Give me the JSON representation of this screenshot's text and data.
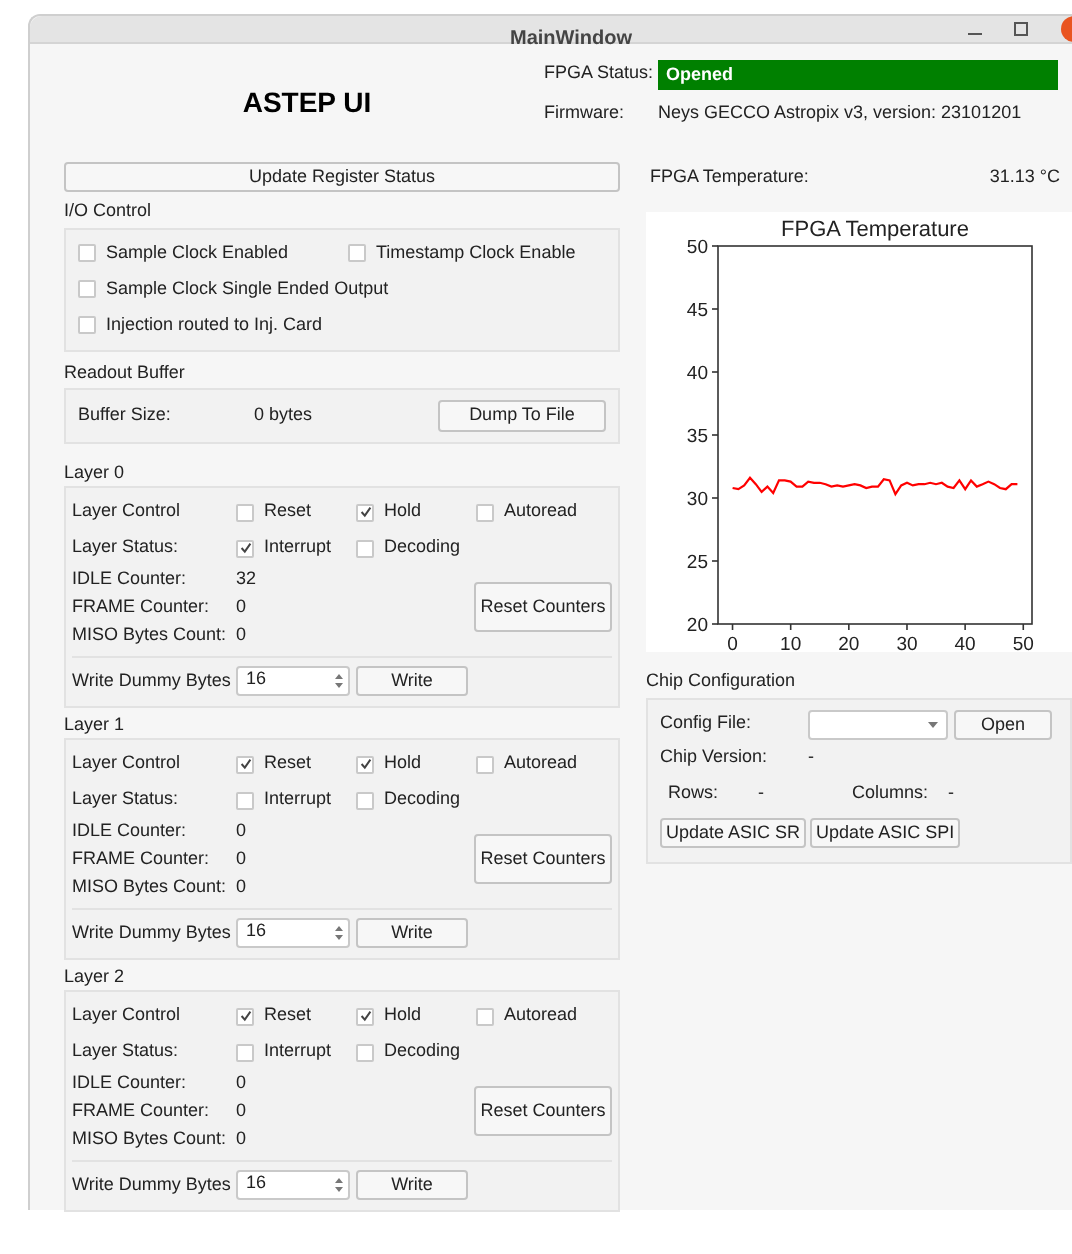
{
  "window": {
    "title": "MainWindow"
  },
  "header": {
    "app_title": "ASTEP UI",
    "fpga_status_label": "FPGA Status:",
    "fpga_status_value": "Opened",
    "firmware_label": "Firmware:",
    "firmware_value": "Neys GECCO Astropix v3, version: 23101201"
  },
  "update_button": "Update Register Status",
  "io_control": {
    "title": "I/O Control",
    "options": [
      {
        "label": "Sample Clock Enabled",
        "checked": false
      },
      {
        "label": "Timestamp Clock Enable",
        "checked": false
      },
      {
        "label": "Sample Clock Single Ended Output",
        "checked": false
      },
      {
        "label": "Injection routed to Inj. Card",
        "checked": false
      }
    ]
  },
  "readout_buffer": {
    "title": "Readout Buffer",
    "buffer_size_label": "Buffer Size:",
    "buffer_size_value": "0 bytes",
    "dump_button": "Dump To File"
  },
  "layers": [
    {
      "title": "Layer 0",
      "control_label": "Layer Control",
      "control": [
        {
          "label": "Reset",
          "checked": false
        },
        {
          "label": "Hold",
          "checked": true
        },
        {
          "label": "Autoread",
          "checked": false
        }
      ],
      "status_label": "Layer Status:",
      "status": [
        {
          "label": "Interrupt",
          "checked": true
        },
        {
          "label": "Decoding",
          "checked": false
        }
      ],
      "counters": [
        {
          "label": "IDLE Counter:",
          "value": "32"
        },
        {
          "label": "FRAME Counter:",
          "value": "0"
        },
        {
          "label": "MISO Bytes Count:",
          "value": "0"
        }
      ],
      "reset_button": "Reset Counters",
      "write_label": "Write Dummy Bytes",
      "write_value": "16",
      "write_button": "Write"
    },
    {
      "title": "Layer 1",
      "control_label": "Layer Control",
      "control": [
        {
          "label": "Reset",
          "checked": true
        },
        {
          "label": "Hold",
          "checked": true
        },
        {
          "label": "Autoread",
          "checked": false
        }
      ],
      "status_label": "Layer Status:",
      "status": [
        {
          "label": "Interrupt",
          "checked": false
        },
        {
          "label": "Decoding",
          "checked": false
        }
      ],
      "counters": [
        {
          "label": "IDLE Counter:",
          "value": "0"
        },
        {
          "label": "FRAME Counter:",
          "value": "0"
        },
        {
          "label": "MISO Bytes Count:",
          "value": "0"
        }
      ],
      "reset_button": "Reset Counters",
      "write_label": "Write Dummy Bytes",
      "write_value": "16",
      "write_button": "Write"
    },
    {
      "title": "Layer 2",
      "control_label": "Layer Control",
      "control": [
        {
          "label": "Reset",
          "checked": true
        },
        {
          "label": "Hold",
          "checked": true
        },
        {
          "label": "Autoread",
          "checked": false
        }
      ],
      "status_label": "Layer Status:",
      "status": [
        {
          "label": "Interrupt",
          "checked": false
        },
        {
          "label": "Decoding",
          "checked": false
        }
      ],
      "counters": [
        {
          "label": "IDLE Counter:",
          "value": "0"
        },
        {
          "label": "FRAME Counter:",
          "value": "0"
        },
        {
          "label": "MISO Bytes Count:",
          "value": "0"
        }
      ],
      "reset_button": "Reset Counters",
      "write_label": "Write Dummy Bytes",
      "write_value": "16",
      "write_button": "Write"
    }
  ],
  "temperature": {
    "label": "FPGA Temperature:",
    "value": "31.13 °C",
    "chart_data": {
      "type": "line",
      "title": "FPGA Temperature",
      "x": [
        0,
        1,
        2,
        3,
        4,
        5,
        6,
        7,
        8,
        9,
        10,
        11,
        12,
        13,
        14,
        15,
        16,
        17,
        18,
        19,
        20,
        21,
        22,
        23,
        24,
        25,
        26,
        27,
        28,
        29,
        30,
        31,
        32,
        33,
        34,
        35,
        36,
        37,
        38,
        39,
        40,
        41,
        42,
        43,
        44,
        45,
        46,
        47,
        48,
        49
      ],
      "series": [
        {
          "color": "#ff0000",
          "values": [
            30.8,
            30.7,
            31.0,
            31.6,
            31.1,
            30.5,
            30.9,
            30.4,
            31.4,
            31.4,
            31.3,
            30.9,
            30.9,
            31.3,
            31.2,
            31.2,
            31.1,
            30.9,
            31.0,
            30.9,
            31.0,
            31.1,
            31.0,
            30.8,
            30.9,
            30.9,
            31.5,
            31.4,
            30.3,
            31.0,
            31.2,
            31.0,
            31.1,
            31.1,
            31.2,
            31.1,
            31.2,
            30.9,
            30.8,
            31.4,
            30.7,
            31.4,
            30.9,
            31.1,
            31.3,
            31.1,
            30.8,
            30.7,
            31.1,
            31.1
          ]
        }
      ],
      "xlim": [
        -2.5,
        51.5
      ],
      "ylim": [
        20,
        50
      ],
      "xticks": [
        0,
        10,
        20,
        30,
        40,
        50
      ],
      "yticks": [
        20,
        25,
        30,
        35,
        40,
        45,
        50
      ]
    }
  },
  "chip_configuration": {
    "title": "Chip Configuration",
    "config_file_label": "Config File:",
    "open_button": "Open",
    "chip_version_label": "Chip Version:",
    "chip_version_value": "-",
    "rows_label": "Rows:",
    "rows_value": "-",
    "columns_label": "Columns:",
    "columns_value": "-",
    "buttons": [
      "Update ASIC SR",
      "Update ASIC SPI"
    ]
  }
}
